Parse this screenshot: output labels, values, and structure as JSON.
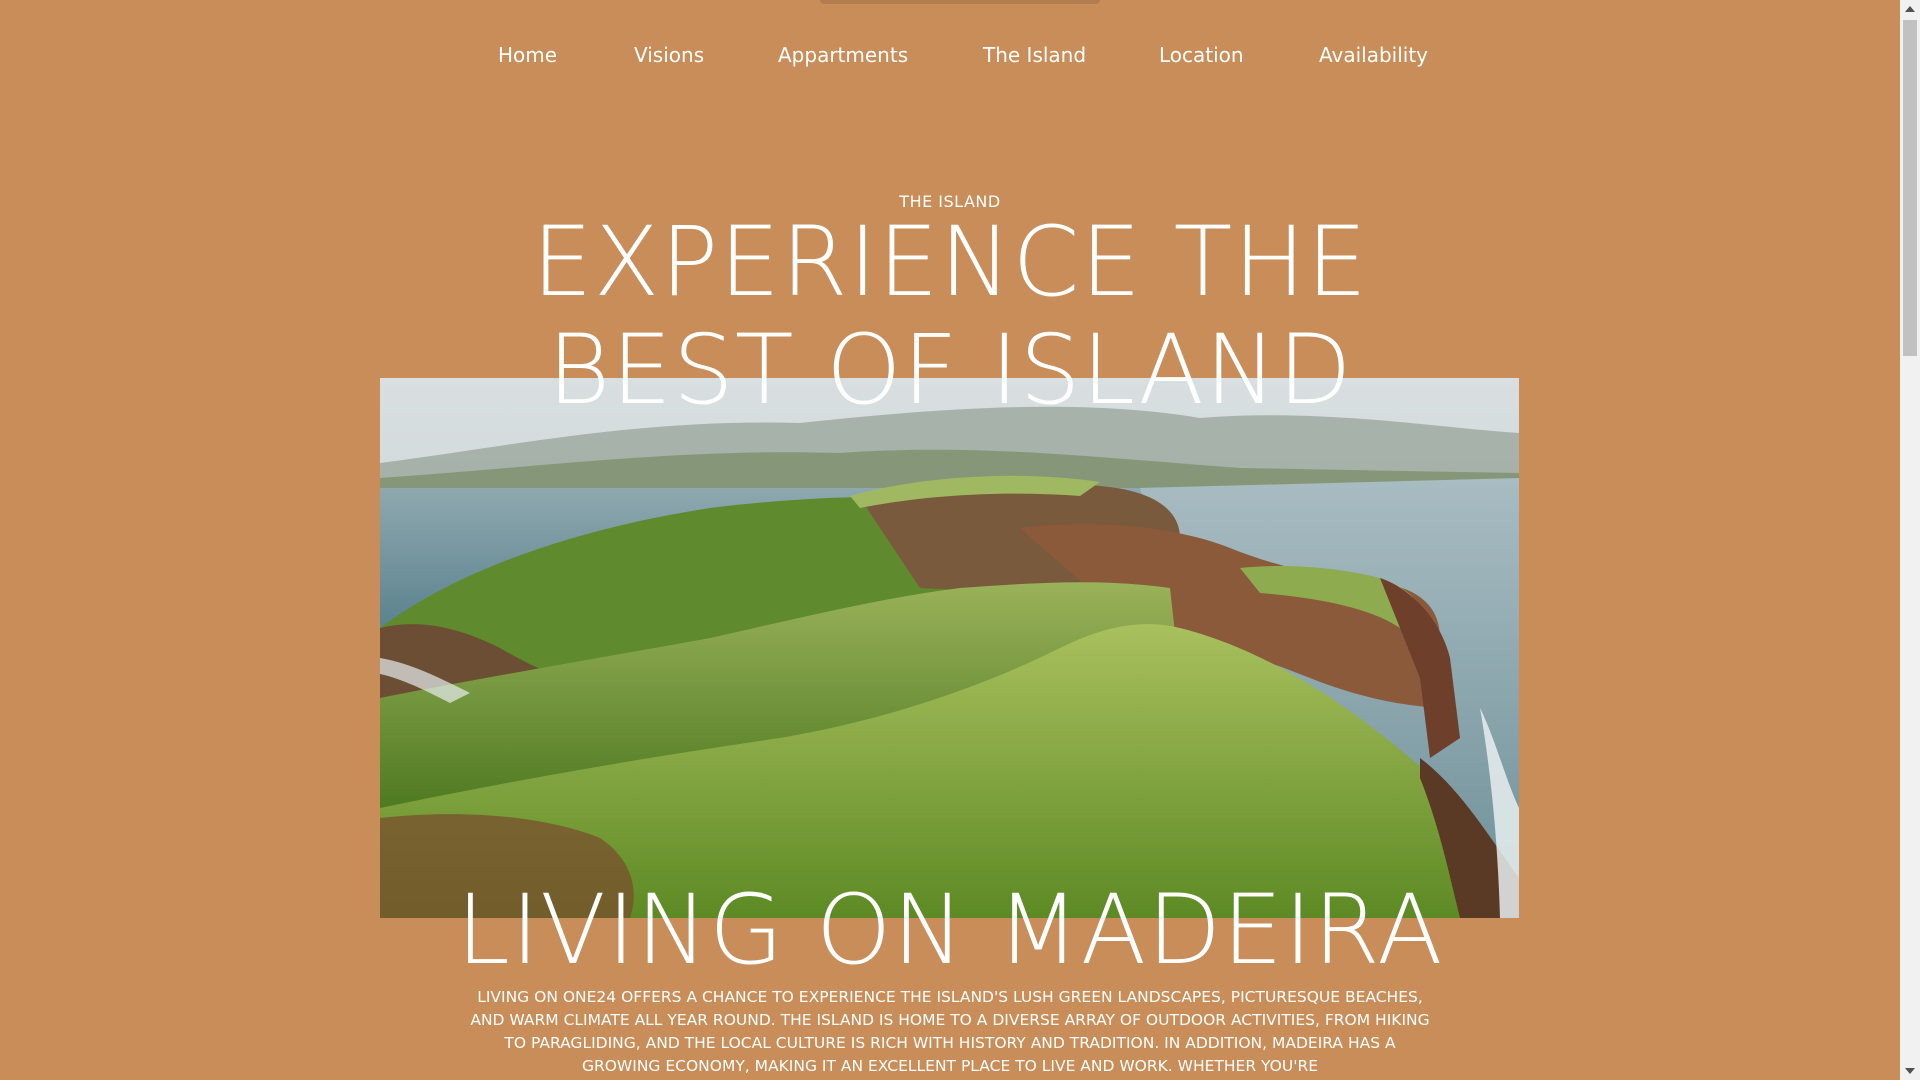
{
  "nav": {
    "items": [
      {
        "label": "Home"
      },
      {
        "label": "Visions"
      },
      {
        "label": "Appartments"
      },
      {
        "label": "The Island"
      },
      {
        "label": "Location"
      },
      {
        "label": "Availability"
      }
    ]
  },
  "hero": {
    "eyebrow": "THE ISLAND",
    "headline_line1": "EXPERIENCE THE",
    "headline_line2": "BEST OF ISLAND"
  },
  "section": {
    "title": "LIVING ON MADEIRA",
    "body": "LIVING ON ONE24 OFFERS A CHANCE TO EXPERIENCE THE ISLAND'S LUSH GREEN LANDSCAPES, PICTURESQUE BEACHES, AND WARM CLIMATE ALL YEAR ROUND. THE ISLAND IS HOME TO A DIVERSE ARRAY OF OUTDOOR ACTIVITIES, FROM HIKING TO PARAGLIDING, AND THE LOCAL CULTURE IS RICH WITH HISTORY AND TRADITION. IN ADDITION, MADEIRA HAS A GROWING ECONOMY, MAKING IT AN EXCELLENT PLACE TO LIVE AND WORK. WHETHER YOU'RE"
  },
  "colors": {
    "background": "#c88d58",
    "text": "#ffffff"
  }
}
